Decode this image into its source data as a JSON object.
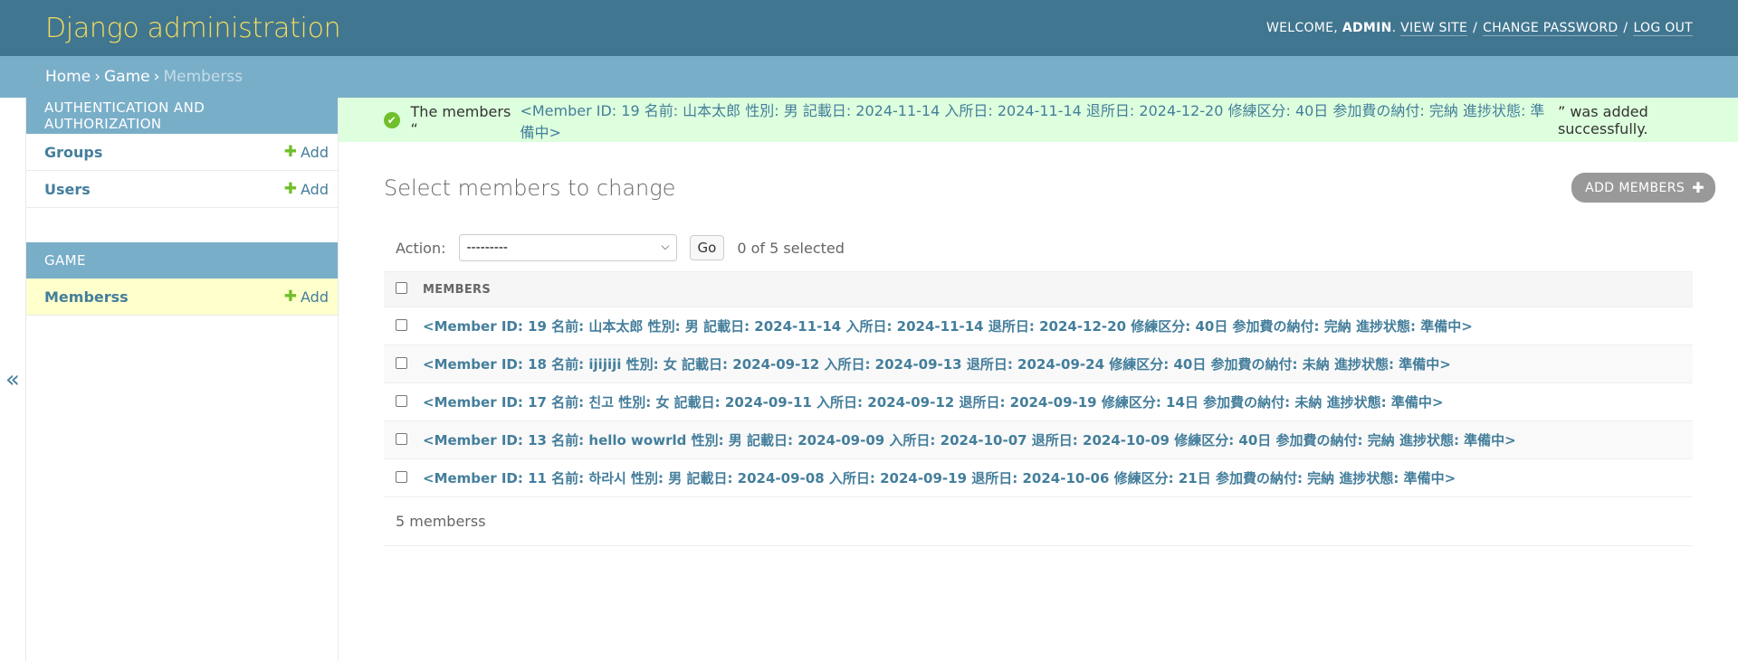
{
  "header": {
    "site_name": "Django administration",
    "welcome": "Welcome,",
    "user": "admin",
    "view_site": "View site",
    "change_password": "Change password",
    "logout": "Log out"
  },
  "breadcrumbs": {
    "home": "Home",
    "app": "Game",
    "current": "Memberss"
  },
  "sidebar": {
    "toggle": "«",
    "modules": [
      {
        "caption": "Authentication and Authorization",
        "rows": [
          {
            "label": "Groups",
            "add": "Add"
          },
          {
            "label": "Users",
            "add": "Add"
          }
        ]
      },
      {
        "caption": "Game",
        "rows": [
          {
            "label": "Memberss",
            "add": "Add"
          }
        ]
      }
    ]
  },
  "message": {
    "prefix": "The members “",
    "link": "<Member ID: 19 名前: 山本太郎 性別: 男 記載日: 2024-11-14 入所日: 2024-11-14 退所日: 2024-12-20 修練区分: 40日 参加費の納付: 完納 進捗状態: 準備中>",
    "suffix": "” was added successfully."
  },
  "page_title": "Select members to change",
  "add_button": "Add members",
  "actions": {
    "label": "Action:",
    "selected_option": "---------",
    "go": "Go",
    "counter": "0 of 5 selected"
  },
  "table": {
    "column": "Members",
    "rows": [
      "<Member ID: 19 名前: 山本太郎 性別: 男 記載日: 2024-11-14 入所日: 2024-11-14 退所日: 2024-12-20 修練区分: 40日 参加費の納付: 完納 進捗状態: 準備中>",
      "<Member ID: 18 名前: ijijiji 性別: 女 記載日: 2024-09-12 入所日: 2024-09-13 退所日: 2024-09-24 修練区分: 40日 参加費の納付: 未納 進捗状態: 準備中>",
      "<Member ID: 17 名前: 친고 性別: 女 記載日: 2024-09-11 入所日: 2024-09-12 退所日: 2024-09-19 修練区分: 14日 参加費の納付: 未納 進捗状態: 準備中>",
      "<Member ID: 13 名前: hello wowrld 性別: 男 記載日: 2024-09-09 入所日: 2024-10-07 退所日: 2024-10-09 修練区分: 40日 参加費の納付: 完納 進捗状態: 準備中>",
      "<Member ID: 11 名前: 하라시 性別: 男 記載日: 2024-09-08 入所日: 2024-09-19 退所日: 2024-10-06 修練区分: 21日 参加費の納付: 完納 進捗状態: 準備中>"
    ]
  },
  "paginator": "5 memberss"
}
